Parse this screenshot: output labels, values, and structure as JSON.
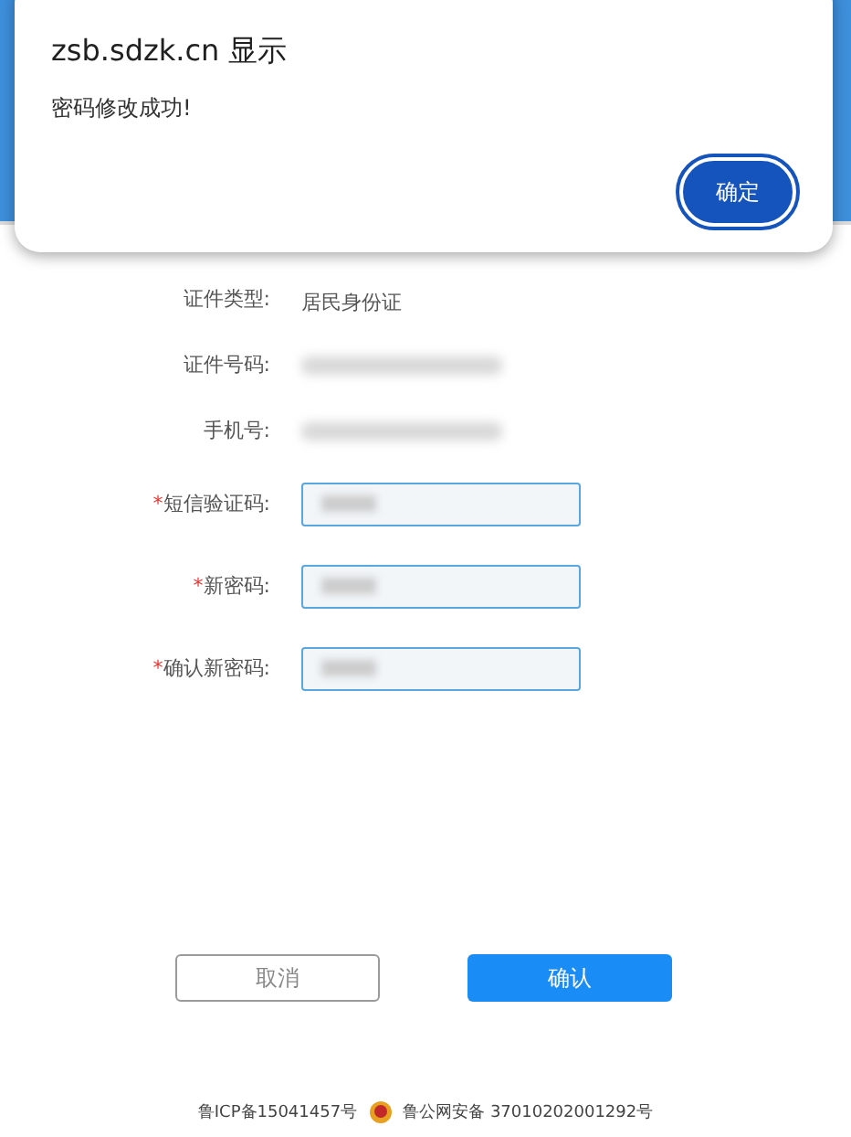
{
  "dialog": {
    "title": "zsb.sdzk.cn 显示",
    "message": "密码修改成功!",
    "ok_button": "确定"
  },
  "form": {
    "rows": [
      {
        "kind": "text",
        "label": "证件类型:",
        "value": "居民身份证"
      },
      {
        "kind": "redacted",
        "label": "证件号码:"
      },
      {
        "kind": "redacted",
        "label": "手机号:"
      },
      {
        "kind": "input",
        "label": "短信验证码:",
        "required_mark": "*"
      },
      {
        "kind": "input",
        "label": "新密码:",
        "required_mark": "*"
      },
      {
        "kind": "input",
        "label": "确认新密码:",
        "required_mark": "*"
      }
    ]
  },
  "buttons": {
    "cancel": "取消",
    "confirm": "确认"
  },
  "footer": {
    "icp": "鲁ICP备15041457号",
    "police": "鲁公网安备 37010202001292号"
  }
}
